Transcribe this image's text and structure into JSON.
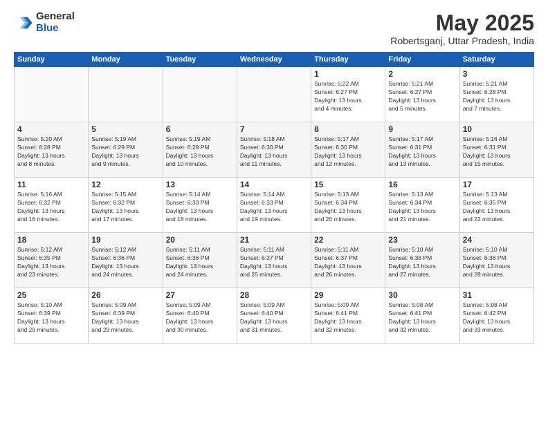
{
  "logo": {
    "general": "General",
    "blue": "Blue"
  },
  "title": "May 2025",
  "subtitle": "Robertsganj, Uttar Pradesh, India",
  "days_of_week": [
    "Sunday",
    "Monday",
    "Tuesday",
    "Wednesday",
    "Thursday",
    "Friday",
    "Saturday"
  ],
  "weeks": [
    [
      {
        "day": "",
        "info": ""
      },
      {
        "day": "",
        "info": ""
      },
      {
        "day": "",
        "info": ""
      },
      {
        "day": "",
        "info": ""
      },
      {
        "day": "1",
        "info": "Sunrise: 5:22 AM\nSunset: 6:27 PM\nDaylight: 13 hours\nand 4 minutes."
      },
      {
        "day": "2",
        "info": "Sunrise: 5:21 AM\nSunset: 6:27 PM\nDaylight: 13 hours\nand 5 minutes."
      },
      {
        "day": "3",
        "info": "Sunrise: 5:21 AM\nSunset: 6:28 PM\nDaylight: 13 hours\nand 7 minutes."
      }
    ],
    [
      {
        "day": "4",
        "info": "Sunrise: 5:20 AM\nSunset: 6:28 PM\nDaylight: 13 hours\nand 8 minutes."
      },
      {
        "day": "5",
        "info": "Sunrise: 5:19 AM\nSunset: 6:29 PM\nDaylight: 13 hours\nand 9 minutes."
      },
      {
        "day": "6",
        "info": "Sunrise: 5:19 AM\nSunset: 6:29 PM\nDaylight: 13 hours\nand 10 minutes."
      },
      {
        "day": "7",
        "info": "Sunrise: 5:18 AM\nSunset: 6:30 PM\nDaylight: 13 hours\nand 11 minutes."
      },
      {
        "day": "8",
        "info": "Sunrise: 5:17 AM\nSunset: 6:30 PM\nDaylight: 13 hours\nand 12 minutes."
      },
      {
        "day": "9",
        "info": "Sunrise: 5:17 AM\nSunset: 6:31 PM\nDaylight: 13 hours\nand 13 minutes."
      },
      {
        "day": "10",
        "info": "Sunrise: 5:16 AM\nSunset: 6:31 PM\nDaylight: 13 hours\nand 15 minutes."
      }
    ],
    [
      {
        "day": "11",
        "info": "Sunrise: 5:16 AM\nSunset: 6:32 PM\nDaylight: 13 hours\nand 16 minutes."
      },
      {
        "day": "12",
        "info": "Sunrise: 5:15 AM\nSunset: 6:32 PM\nDaylight: 13 hours\nand 17 minutes."
      },
      {
        "day": "13",
        "info": "Sunrise: 5:14 AM\nSunset: 6:33 PM\nDaylight: 13 hours\nand 18 minutes."
      },
      {
        "day": "14",
        "info": "Sunrise: 5:14 AM\nSunset: 6:33 PM\nDaylight: 13 hours\nand 19 minutes."
      },
      {
        "day": "15",
        "info": "Sunrise: 5:13 AM\nSunset: 6:34 PM\nDaylight: 13 hours\nand 20 minutes."
      },
      {
        "day": "16",
        "info": "Sunrise: 5:13 AM\nSunset: 6:34 PM\nDaylight: 13 hours\nand 21 minutes."
      },
      {
        "day": "17",
        "info": "Sunrise: 5:13 AM\nSunset: 6:35 PM\nDaylight: 13 hours\nand 22 minutes."
      }
    ],
    [
      {
        "day": "18",
        "info": "Sunrise: 5:12 AM\nSunset: 6:35 PM\nDaylight: 13 hours\nand 23 minutes."
      },
      {
        "day": "19",
        "info": "Sunrise: 5:12 AM\nSunset: 6:36 PM\nDaylight: 13 hours\nand 24 minutes."
      },
      {
        "day": "20",
        "info": "Sunrise: 5:11 AM\nSunset: 6:36 PM\nDaylight: 13 hours\nand 24 minutes."
      },
      {
        "day": "21",
        "info": "Sunrise: 5:11 AM\nSunset: 6:37 PM\nDaylight: 13 hours\nand 25 minutes."
      },
      {
        "day": "22",
        "info": "Sunrise: 5:11 AM\nSunset: 6:37 PM\nDaylight: 13 hours\nand 26 minutes."
      },
      {
        "day": "23",
        "info": "Sunrise: 5:10 AM\nSunset: 6:38 PM\nDaylight: 13 hours\nand 27 minutes."
      },
      {
        "day": "24",
        "info": "Sunrise: 5:10 AM\nSunset: 6:38 PM\nDaylight: 13 hours\nand 28 minutes."
      }
    ],
    [
      {
        "day": "25",
        "info": "Sunrise: 5:10 AM\nSunset: 6:39 PM\nDaylight: 13 hours\nand 29 minutes."
      },
      {
        "day": "26",
        "info": "Sunrise: 5:09 AM\nSunset: 6:39 PM\nDaylight: 13 hours\nand 29 minutes."
      },
      {
        "day": "27",
        "info": "Sunrise: 5:09 AM\nSunset: 6:40 PM\nDaylight: 13 hours\nand 30 minutes."
      },
      {
        "day": "28",
        "info": "Sunrise: 5:09 AM\nSunset: 6:40 PM\nDaylight: 13 hours\nand 31 minutes."
      },
      {
        "day": "29",
        "info": "Sunrise: 5:09 AM\nSunset: 6:41 PM\nDaylight: 13 hours\nand 32 minutes."
      },
      {
        "day": "30",
        "info": "Sunrise: 5:08 AM\nSunset: 6:41 PM\nDaylight: 13 hours\nand 32 minutes."
      },
      {
        "day": "31",
        "info": "Sunrise: 5:08 AM\nSunset: 6:42 PM\nDaylight: 13 hours\nand 33 minutes."
      }
    ]
  ]
}
